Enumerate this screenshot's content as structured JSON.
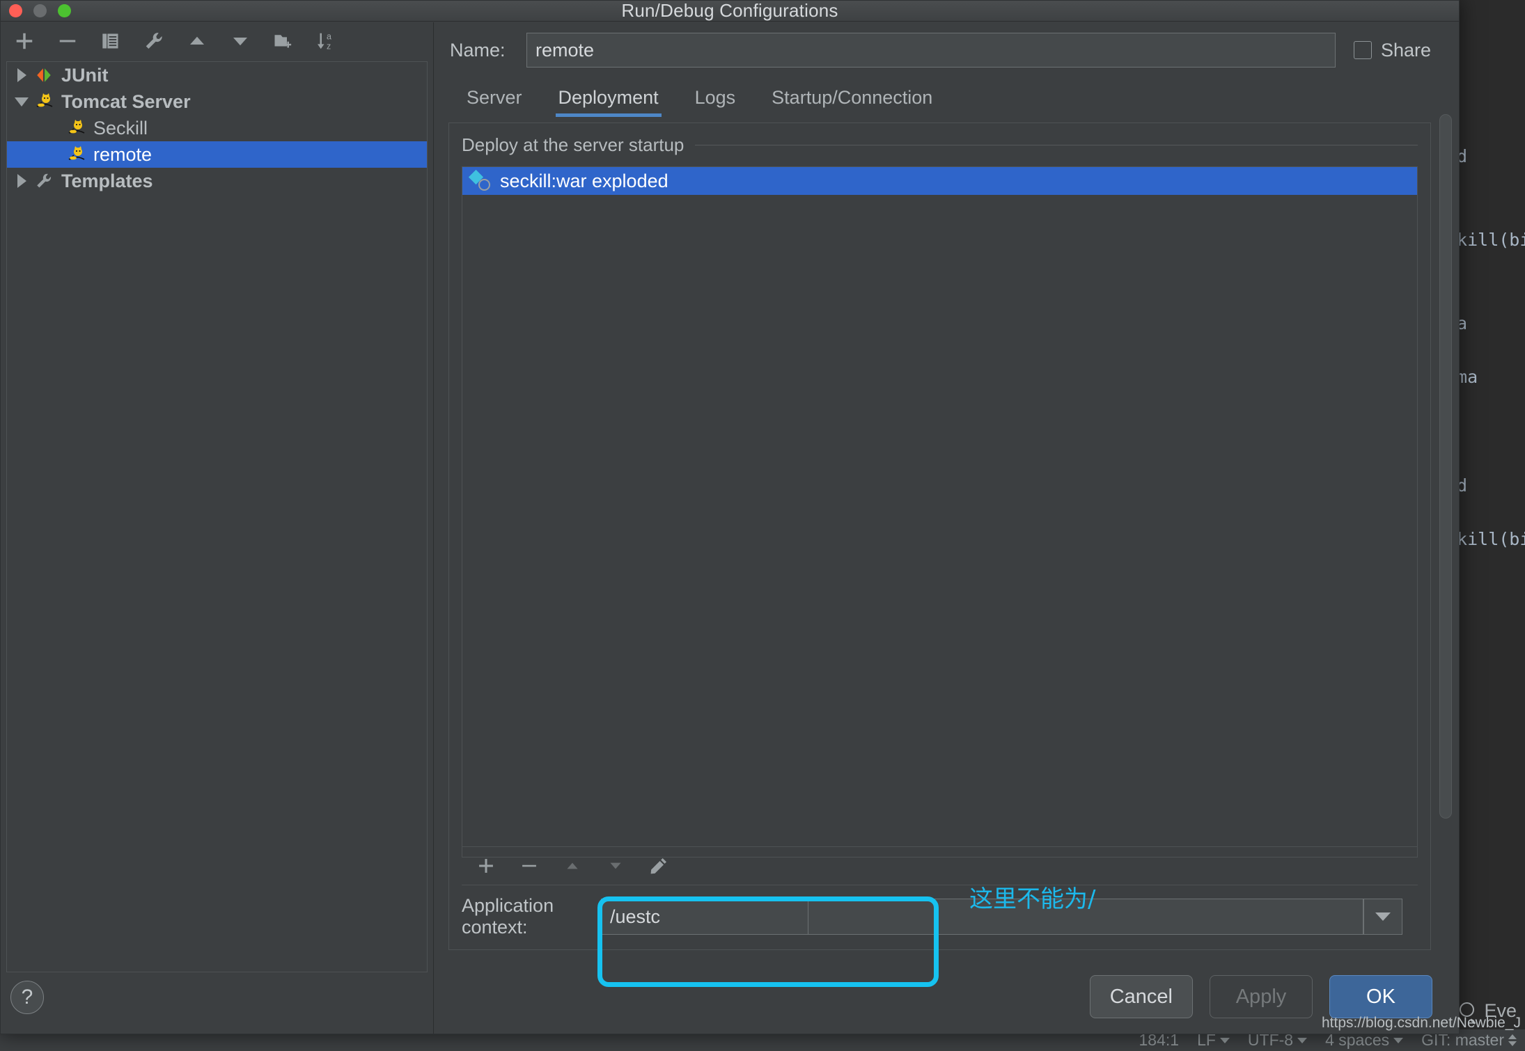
{
  "window": {
    "title": "Run/Debug Configurations",
    "traffic_lights": [
      "close-red",
      "minimize-gray",
      "maximize-green"
    ]
  },
  "left_pane": {
    "toolbar": [
      {
        "name": "add-configuration-button",
        "icon": "plus-icon"
      },
      {
        "name": "remove-configuration-button",
        "icon": "minus-icon"
      },
      {
        "name": "copy-configuration-button",
        "icon": "copy-icon"
      },
      {
        "name": "edit-templates-button",
        "icon": "wrench-icon"
      },
      {
        "name": "move-up-button",
        "icon": "triangle-up-icon"
      },
      {
        "name": "move-down-button",
        "icon": "triangle-down-icon"
      },
      {
        "name": "create-folder-button",
        "icon": "folder-add-icon"
      },
      {
        "name": "sort-configurations-button",
        "icon": "sort-az-icon"
      }
    ],
    "tree": [
      {
        "label": "JUnit",
        "icon": "junit-icon",
        "expander": "collapsed",
        "depth": 0,
        "bold": true,
        "selected": false
      },
      {
        "label": "Tomcat Server",
        "icon": "tomcat-icon",
        "expander": "expanded",
        "depth": 0,
        "bold": true,
        "selected": false
      },
      {
        "label": "Seckill",
        "icon": "tomcat-icon",
        "expander": "none",
        "depth": 1,
        "bold": false,
        "selected": false
      },
      {
        "label": "remote",
        "icon": "tomcat-icon",
        "expander": "none",
        "depth": 1,
        "bold": false,
        "selected": true
      },
      {
        "label": "Templates",
        "icon": "wrench-icon",
        "expander": "collapsed",
        "depth": 0,
        "bold": true,
        "selected": false
      }
    ],
    "help_label": "?"
  },
  "right_pane": {
    "name_label": "Name:",
    "name_value": "remote",
    "name_placeholder": "",
    "share_label": "Share",
    "share_checked": false,
    "tabs": [
      {
        "label": "Server",
        "active": false
      },
      {
        "label": "Deployment",
        "active": true
      },
      {
        "label": "Logs",
        "active": false
      },
      {
        "label": "Startup/Connection",
        "active": false
      }
    ],
    "section_title": "Deploy at the server startup",
    "deploy_items": [
      {
        "label": "seckill:war exploded",
        "icon": "artifact-icon",
        "selected": true
      }
    ],
    "list_toolbar": [
      {
        "name": "add-artifact-button",
        "icon": "plus-icon",
        "enabled": true
      },
      {
        "name": "remove-artifact-button",
        "icon": "minus-icon",
        "enabled": true
      },
      {
        "name": "move-up-button",
        "icon": "triangle-up-icon",
        "enabled": false
      },
      {
        "name": "move-down-button",
        "icon": "triangle-down-icon",
        "enabled": false
      },
      {
        "name": "edit-artifact-button",
        "icon": "pencil-icon",
        "enabled": true
      }
    ],
    "app_context_label": "Application context:",
    "app_context_value": "/uestc"
  },
  "annotation": {
    "text": "这里不能为/",
    "color": "#1cb9ec"
  },
  "buttons": {
    "cancel": "Cancel",
    "apply": "Apply",
    "ok": "OK"
  },
  "background_ide": {
    "fragments": [
      "ed",
      "ckill(bigi",
      "ma",
      "ema",
      "ed",
      "ckill(bigi"
    ],
    "event_log_label": "Eve",
    "status_bar": [
      "184:1",
      "LF",
      "UTF-8",
      "4 spaces",
      "GIT: master"
    ]
  },
  "watermark": "https://blog.csdn.net/Newbie_J",
  "colors": {
    "accent_blue": "#2f65ca",
    "tab_underline": "#4e87c7",
    "ok_button": "#3d6699",
    "annotation_cyan": "#16c2f0",
    "panel_bg": "#3c3f41"
  }
}
